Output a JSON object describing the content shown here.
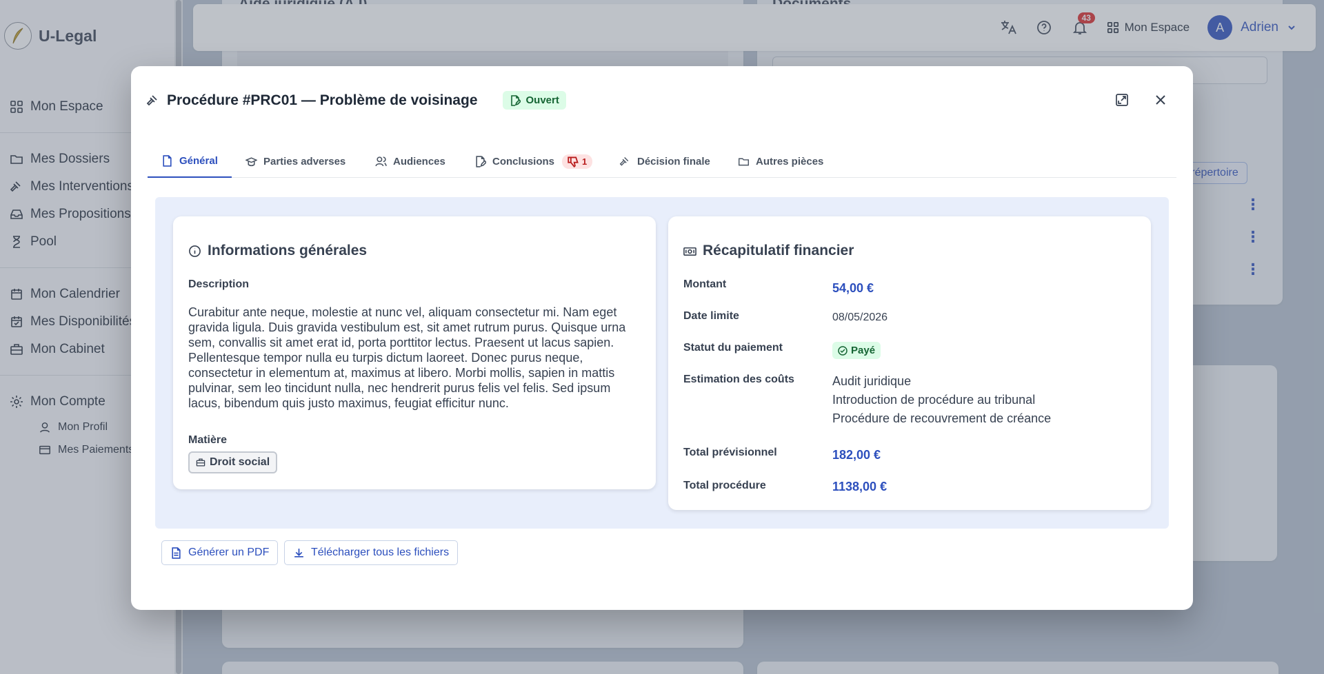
{
  "app": {
    "brand": "U-Legal"
  },
  "sidebar": {
    "items": [
      {
        "label": "Mon Espace",
        "icon": "grid-icon"
      },
      {
        "label": "Mes Dossiers",
        "icon": "folder-icon"
      },
      {
        "label": "Mes Interventions",
        "icon": "gavel-icon"
      },
      {
        "label": "Mes Propositions",
        "icon": "inbox-icon"
      },
      {
        "label": "Pool",
        "icon": "hourglass-icon"
      },
      {
        "label": "Mon Calendrier",
        "icon": "calendar-icon"
      },
      {
        "label": "Mes Disponibilités",
        "icon": "calendar-check-icon"
      },
      {
        "label": "Mon Cabinet",
        "icon": "briefcase-icon"
      },
      {
        "label": "Mon Compte",
        "icon": "gear-icon"
      }
    ],
    "sub_items": [
      {
        "label": "Mon Profil",
        "icon": "user-icon"
      },
      {
        "label": "Mes Paiements",
        "icon": "credit-card-icon"
      }
    ]
  },
  "topbar": {
    "notification_count": "43",
    "espace_label": "Mon Espace",
    "user_initial": "A",
    "user_name": "Adrien"
  },
  "background": {
    "card_left_title": "Aide juridique (AJ)",
    "card_right_title": "Documents",
    "repertoire_button": "au répertoire"
  },
  "modal": {
    "title": "Procédure #PRC01 — Problème de voisinage",
    "status": "Ouvert",
    "tabs": [
      {
        "label": "Général",
        "icon": "file-icon",
        "active": true
      },
      {
        "label": "Parties adverses",
        "icon": "hat-icon"
      },
      {
        "label": "Audiences",
        "icon": "users-icon"
      },
      {
        "label": "Conclusions",
        "icon": "file-pen-icon",
        "count": "1"
      },
      {
        "label": "Décision finale",
        "icon": "gavel-icon"
      },
      {
        "label": "Autres pièces",
        "icon": "folder-icon"
      }
    ],
    "info": {
      "title": "Informations générales",
      "description_label": "Description",
      "description": "Curabitur ante neque, molestie at nunc vel, aliquam consectetur mi. Nam eget gravida ligula. Duis gravida vestibulum est, sit amet rutrum purus. Quisque urna sem, convallis sit amet erat id, porta porttitor lectus. Praesent ut lacus sapien. Pellentesque tempor nulla eu turpis dictum laoreet. Donec purus neque, consectetur in elementum at, maximus at libero. Morbi mollis, sapien in mattis pulvinar, sem leo tincidunt nulla, nec hendrerit purus felis vel felis. Sed ipsum lacus, bibendum quis justo maximus, feugiat efficitur nunc.",
      "matiere_label": "Matière",
      "matiere": "Droit social"
    },
    "finance": {
      "title": "Récapitulatif financier",
      "montant_label": "Montant",
      "montant": "54,00 €",
      "date_label": "Date limite",
      "date": "08/05/2026",
      "statut_label": "Statut du paiement",
      "statut": "Payé",
      "estimation_label": "Estimation des coûts",
      "estimation": [
        "Audit juridique",
        "Introduction de procédure au tribunal",
        "Procédure de recouvrement de créance"
      ],
      "total_prev_label": "Total prévisionnel",
      "total_prev": "182,00 €",
      "total_proc_label": "Total procédure",
      "total_proc": "1138,00 €"
    },
    "actions": {
      "pdf": "Générer un PDF",
      "download": "Télécharger tous les fichiers"
    }
  },
  "colors": {
    "accent": "#2c4fbd",
    "success": "#166534",
    "danger": "#dc2626"
  }
}
